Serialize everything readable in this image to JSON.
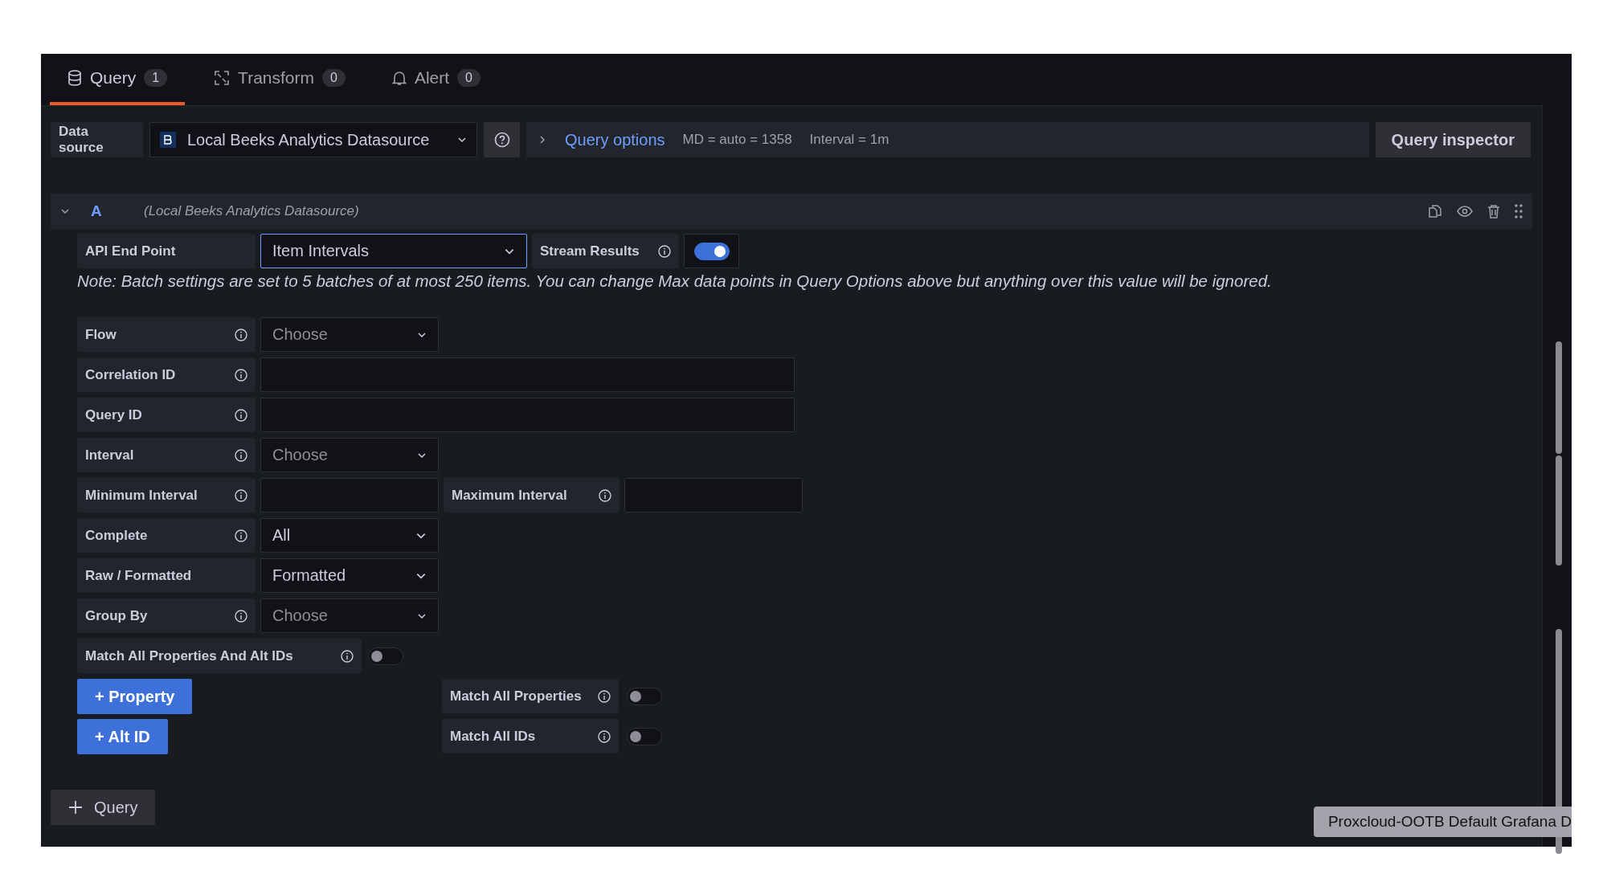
{
  "tabs": [
    {
      "label": "Query",
      "count": "1",
      "selected": true
    },
    {
      "label": "Transform",
      "count": "0",
      "selected": false
    },
    {
      "label": "Alert",
      "count": "0",
      "selected": false
    }
  ],
  "datasource": {
    "label": "Data source",
    "value": "Local Beeks Analytics Datasource"
  },
  "query_options": {
    "label": "Query options",
    "expanded": false,
    "md": "MD = auto = 1358",
    "interval": "Interval = 1m"
  },
  "query_inspector": "Query inspector",
  "query": {
    "ref": "A",
    "datasource": "(Local Beeks Analytics Datasource)",
    "expanded": true,
    "endpoint": {
      "label": "API End Point",
      "value": "Item Intervals",
      "focused": true
    },
    "stream": {
      "label": "Stream Results",
      "on": true
    },
    "note": "Note: Batch settings are set to 5 batches of at most 250 items. You can change Max data points in Query Options above but anything over this value will be ignored.",
    "rows": [
      [
        {
          "kind": "label",
          "text": "Flow",
          "info": true
        },
        {
          "kind": "select",
          "placeholder": "Choose"
        }
      ],
      [
        {
          "kind": "label",
          "text": "Correlation ID",
          "info": true
        },
        {
          "kind": "wide-input"
        }
      ],
      [
        {
          "kind": "label",
          "text": "Query ID",
          "info": true
        },
        {
          "kind": "wide-input"
        }
      ],
      [
        {
          "kind": "label",
          "text": "Interval",
          "info": true
        },
        {
          "kind": "select",
          "placeholder": "Choose"
        }
      ],
      [
        {
          "kind": "label",
          "text": "Minimum Interval",
          "info": true
        },
        {
          "kind": "input"
        },
        {
          "kind": "label",
          "text": "Maximum Interval",
          "info": true
        },
        {
          "kind": "input"
        }
      ],
      [
        {
          "kind": "label",
          "text": "Complete",
          "info": true
        },
        {
          "kind": "native-select",
          "value": "All"
        }
      ],
      [
        {
          "kind": "label",
          "text": "Raw / Formatted",
          "info": false
        },
        {
          "kind": "native-select",
          "value": "Formatted"
        }
      ],
      [
        {
          "kind": "label",
          "text": "Group By",
          "info": true
        },
        {
          "kind": "select",
          "placeholder": "Choose"
        }
      ]
    ],
    "match_all": {
      "label": "Match All Properties And Alt IDs",
      "on": false
    },
    "adders": [
      {
        "button": "+ Property",
        "toggle": {
          "label": "Match All Properties",
          "on": false
        }
      },
      {
        "button": "+ Alt ID",
        "toggle": {
          "label": "Match All IDs",
          "on": false
        }
      }
    ]
  },
  "add_query": "Query",
  "tooltip": "Proxcloud-OOTB Default Grafana D"
}
